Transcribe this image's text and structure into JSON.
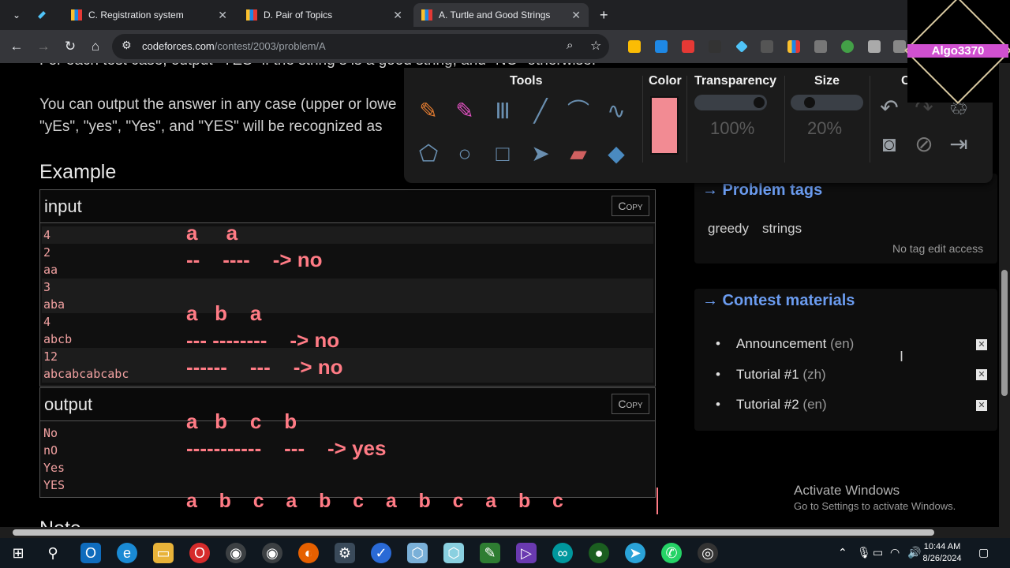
{
  "browser": {
    "tabs": [
      {
        "title": "C. Registration system",
        "color": "#e53935"
      },
      {
        "title": "D. Pair of Topics",
        "color": "#e53935"
      },
      {
        "title": "A. Turtle and Good Strings",
        "color": "#1e88e5",
        "active": true
      }
    ],
    "url_domain": "codeforces.com",
    "url_path": "/contest/2003/problem/A"
  },
  "problem": {
    "cut_line": "For each test case, output \"YES\" if the string s is a good string, and \"NO\" otherwise.",
    "case_line1": "You can output the answer in any case (upper or lowe",
    "case_line2": "\"yEs\", \"yes\", \"Yes\", and \"YES\" will be recognized as",
    "example_heading": "Example",
    "note_heading": "Note"
  },
  "input_box": {
    "label": "input",
    "copy": "Copy",
    "lines": [
      "4",
      "2",
      "aa",
      "3",
      "aba",
      "4",
      "abcb",
      "12",
      "abcabcabcabc"
    ]
  },
  "output_box": {
    "label": "output",
    "copy": "Copy",
    "lines": [
      "No",
      "nO",
      "Yes",
      "YES"
    ]
  },
  "annotations": {
    "a1": "a     a",
    "a1_dash": "--    ----    -> no",
    "a2": "a   b    a",
    "a2_dash": "--- --------    -> no",
    "a3_dash": "------    ---    -> no",
    "a4": "a   b    c    b",
    "a4_dash": "-----------    ---    -> yes",
    "a5": "a    b    c    a    b    c    a    b    c    a    b    c"
  },
  "sidebar": {
    "tags_heading": "→ Problem tags",
    "tags": [
      "greedy",
      "strings"
    ],
    "no_edit": "No tag edit access",
    "materials_heading": "→ Contest materials",
    "materials": [
      {
        "name": "Announcement",
        "lang": "(en)"
      },
      {
        "name": "Tutorial #1",
        "lang": "(zh)"
      },
      {
        "name": "Tutorial #2",
        "lang": "(en)"
      }
    ]
  },
  "draw_toolbar": {
    "tools_label": "Tools",
    "color_label": "Color",
    "transparency_label": "Transparency",
    "size_label": "Size",
    "transparency_value": "100%",
    "size_value": "20%",
    "transparency_level": 1.0,
    "size_level": 0.2,
    "color_hex": "#f28b93",
    "cut_label": "C"
  },
  "overlay_logo": {
    "name": "Algo3370"
  },
  "windows": {
    "activate_title": "Activate Windows",
    "activate_sub": "Go to Settings to activate Windows.",
    "time": "10:44 AM",
    "date": "8/26/2024"
  }
}
